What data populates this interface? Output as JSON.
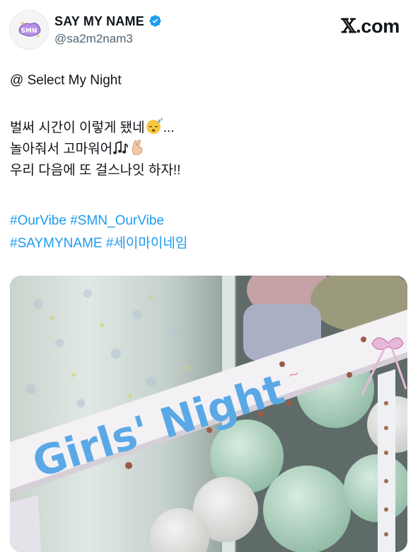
{
  "profile": {
    "display_name": "SAY MY NAME",
    "handle": "@sa2m2nam3",
    "verified": true,
    "avatar_icon": "smn-logo-avatar"
  },
  "source": {
    "x_glyph": "𝕏",
    "domain": ".com"
  },
  "post": {
    "mention_line": "@ Select My Night",
    "line1_text": "벌써 시간이 이렇게 됐네",
    "line1_emoji": "sleepy-face-emoji",
    "line1_tail": "...",
    "line2_text": "놀아줘서 고마워어",
    "line2_emojis": [
      "musical-notes-emoji",
      "crossed-fingers-emoji"
    ],
    "line3_text": "우리 다음에 또 걸스나잇 하자!!",
    "hashtags_row1": [
      "#OurVibe",
      "#SMN_OurVibe"
    ],
    "hashtags_row2": [
      "#SAYMYNAME",
      "#세이마이네임"
    ]
  },
  "media": {
    "banner_text": "Girls' Night",
    "colors": {
      "balloon": "#b6d8c6",
      "banner": "#f3f1f4",
      "letter_blue": "#5aa9e6",
      "letter_pink": "#e58fb0"
    }
  },
  "colors": {
    "hashtag": "#1d9bf0",
    "handle": "#536471",
    "verified": "#1d9bf0"
  }
}
